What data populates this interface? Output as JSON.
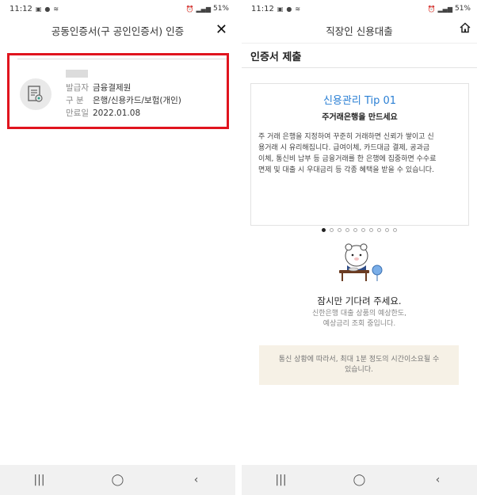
{
  "left": {
    "status": {
      "time": "11:12",
      "battery": "51%"
    },
    "title": "공동인증서(구 공인인증서) 인증",
    "close_glyph": "✕",
    "cert": {
      "rows": [
        {
          "key": "발급자",
          "value": "금융결제원"
        },
        {
          "key": "구 분",
          "value": "은행/신용카드/보험(개인)"
        },
        {
          "key": "만료일",
          "value": "2022.01.08"
        }
      ]
    },
    "highlight_color": "#e0141e"
  },
  "right": {
    "status": {
      "time": "11:12",
      "battery": "51%"
    },
    "title": "직장인 신용대출",
    "section_title": "인증서 제출",
    "tip": {
      "title": "신용관리 Tip 01",
      "subtitle": "주거래은행을 만드세요",
      "lines": [
        "주 거래 은행을 지정하여 꾸준히 거래하면 신뢰가 쌓이고 신",
        "용거래 시 유리해집니다. 급여이체, 카드대금 결제, 공과금",
        "이체, 통신비 납부 등 금융거래를 한 은행에 집중하면 수수료",
        "면제 및 대출 시 우대금리 등 각종 혜택을 받을 수 있습니다."
      ],
      "accent": "#2a7fd4"
    },
    "carousel": {
      "total": 10,
      "active": 1
    },
    "wait": {
      "title": "잠시만 기다려 주세요.",
      "lines": [
        "신한은행 대출 상품의 예상한도,",
        "예상금리 조회 중입니다."
      ]
    },
    "notice_lines": [
      "통신 상황에 따라서, 최대 1분 정도의 시간이소요될 수",
      "있습니다."
    ]
  },
  "navbar": {
    "recent": "|||",
    "home": "◯",
    "back": "‹"
  }
}
